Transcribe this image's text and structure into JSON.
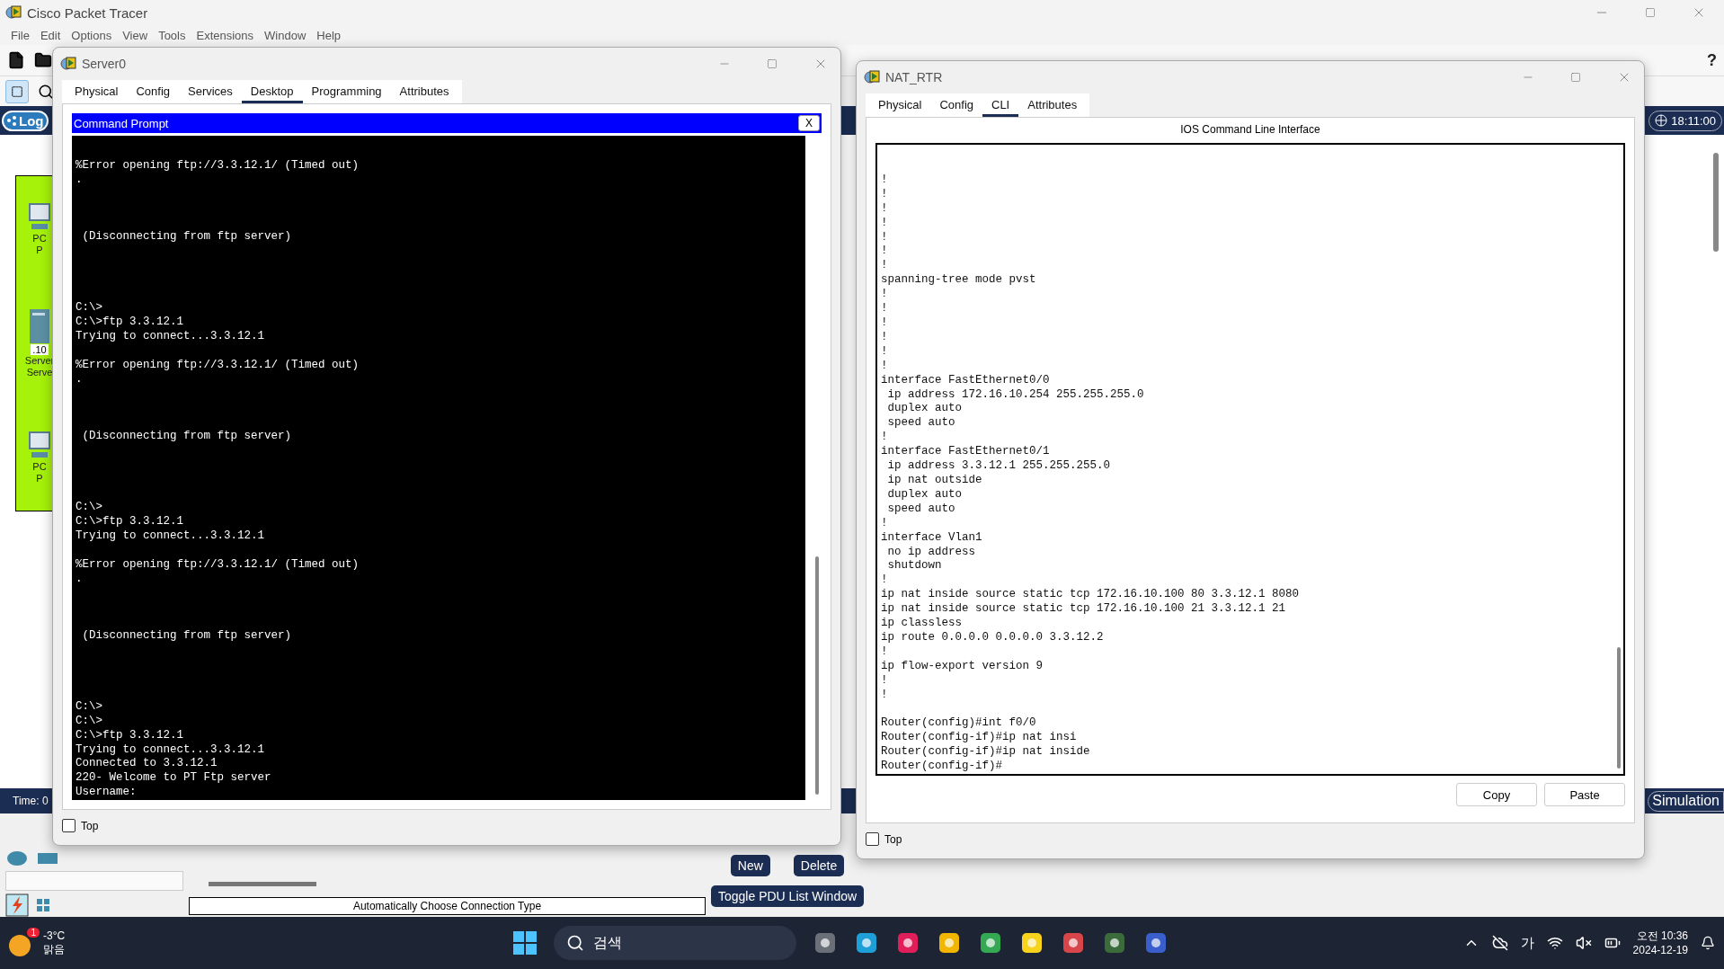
{
  "app": {
    "title": "Cisco Packet Tracer",
    "menu": [
      "File",
      "Edit",
      "Options",
      "View",
      "Tools",
      "Extensions",
      "Window",
      "Help"
    ],
    "help_glyph": "?"
  },
  "logical_tab": {
    "label": "Log"
  },
  "sim_clock": "18:11:00",
  "workspace_devices": [
    {
      "kind": "pc",
      "label_lines": [
        "PC",
        "P"
      ]
    },
    {
      "kind": "server",
      "tag": ".10",
      "label_lines": [
        "Server",
        "Serve"
      ]
    },
    {
      "kind": "pc",
      "label_lines": [
        "PC",
        "P"
      ]
    }
  ],
  "time_label": "Time: 0",
  "mode_button": "Simulation",
  "connection_type": "Automatically Choose Connection Type",
  "pdu_buttons": [
    "New",
    "Delete"
  ],
  "toggle_pdu": "Toggle PDU List Window",
  "windows": [
    {
      "kind": "terminal",
      "title": "Server0",
      "tabs": [
        {
          "label": "Physical",
          "selected": false
        },
        {
          "label": "Config",
          "selected": false
        },
        {
          "label": "Services",
          "selected": false
        },
        {
          "label": "Desktop",
          "selected": true
        },
        {
          "label": "Programming",
          "selected": false
        },
        {
          "label": "Attributes",
          "selected": false
        }
      ],
      "panel_title": "Command Prompt",
      "panel_close": "X",
      "output": "%Error opening ftp://3.3.12.1/ (Timed out)\n.\n\n\n\n (Disconnecting from ftp server)\n\n\n\n\nC:\\>\nC:\\>ftp 3.3.12.1\nTrying to connect...3.3.12.1\n\n%Error opening ftp://3.3.12.1/ (Timed out)\n.\n\n\n\n (Disconnecting from ftp server)\n\n\n\n\nC:\\>\nC:\\>ftp 3.3.12.1\nTrying to connect...3.3.12.1\n\n%Error opening ftp://3.3.12.1/ (Timed out)\n.\n\n\n\n (Disconnecting from ftp server)\n\n\n\n\nC:\\>\nC:\\>\nC:\\>ftp 3.3.12.1\nTrying to connect...3.3.12.1\nConnected to 3.3.12.1\n220- Welcome to PT Ftp server\nUsername:",
      "top_label": "Top",
      "top_checked": false
    },
    {
      "kind": "cli",
      "title": "NAT_RTR",
      "tabs": [
        {
          "label": "Physical",
          "selected": false
        },
        {
          "label": "Config",
          "selected": false
        },
        {
          "label": "CLI",
          "selected": true
        },
        {
          "label": "Attributes",
          "selected": false
        }
      ],
      "heading": "IOS Command Line Interface",
      "output": "!\n!\n!\n!\n!\n!\n!\nspanning-tree mode pvst\n!\n!\n!\n!\n!\n!\ninterface FastEthernet0/0\n ip address 172.16.10.254 255.255.255.0\n duplex auto\n speed auto\n!\ninterface FastEthernet0/1\n ip address 3.3.12.1 255.255.255.0\n ip nat outside\n duplex auto\n speed auto\n!\ninterface Vlan1\n no ip address\n shutdown\n!\nip nat inside source static tcp 172.16.10.100 80 3.3.12.1 8080\nip nat inside source static tcp 172.16.10.100 21 3.3.12.1 21\nip classless\nip route 0.0.0.0 0.0.0.0 3.3.12.2\n!\nip flow-export version 9\n!\n!\n\nRouter(config)#int f0/0\nRouter(config-if)#ip nat insi\nRouter(config-if)#ip nat inside\nRouter(config-if)#",
      "buttons": [
        "Copy",
        "Paste"
      ],
      "top_label": "Top",
      "top_checked": false
    }
  ],
  "taskbar": {
    "weather": {
      "badge": "1",
      "temp": "-3°C",
      "condition": "맑음"
    },
    "search_label": "검색",
    "ime": "가",
    "time": "오전 10:36",
    "date": "2024-12-19"
  }
}
